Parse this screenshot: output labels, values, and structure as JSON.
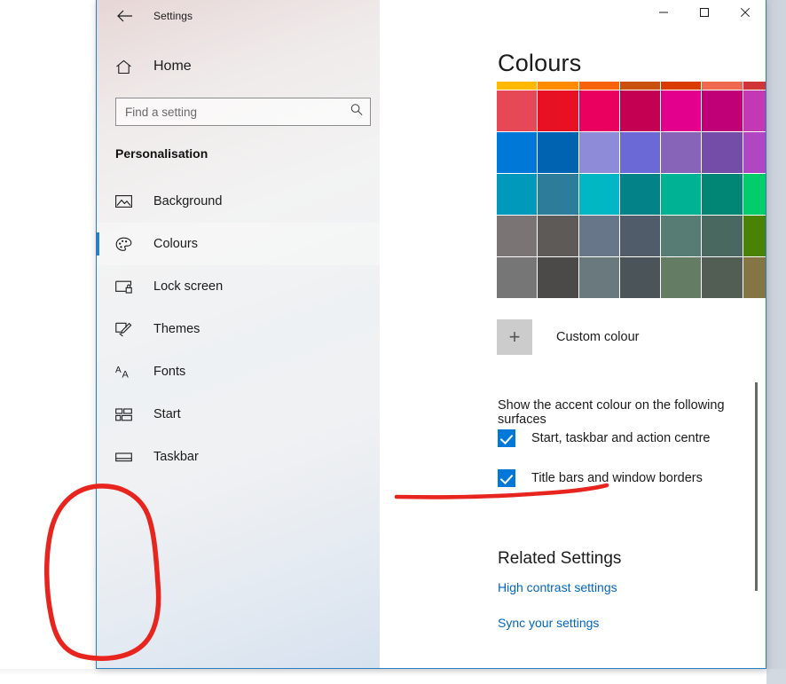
{
  "window": {
    "title": "Settings",
    "back_icon": "back-arrow-icon",
    "controls": {
      "minimize": "─",
      "maximize": "□",
      "close": "✕"
    },
    "accent_border_colour": "#2a7fc4"
  },
  "sidebar": {
    "home": {
      "label": "Home",
      "icon": "home-icon"
    },
    "search": {
      "placeholder": "Find a setting",
      "value": "",
      "icon": "search-icon"
    },
    "category": "Personalisation",
    "items": [
      {
        "label": "Background",
        "icon": "picture-icon",
        "selected": false
      },
      {
        "label": "Colours",
        "icon": "palette-icon",
        "selected": true
      },
      {
        "label": "Lock screen",
        "icon": "lock-screen-icon",
        "selected": false
      },
      {
        "label": "Themes",
        "icon": "brush-icon",
        "selected": false
      },
      {
        "label": "Fonts",
        "icon": "font-icon",
        "selected": false
      },
      {
        "label": "Start",
        "icon": "start-tiles-icon",
        "selected": false
      },
      {
        "label": "Taskbar",
        "icon": "taskbar-icon",
        "selected": false
      }
    ]
  },
  "main": {
    "heading": "Colours",
    "swatch_rows": [
      {
        "clipped": true,
        "colours": [
          "#ffb900",
          "#ff8c00",
          "#f7630c",
          "#ca5010",
          "#da3b01",
          "#ef6950",
          "#d13438",
          "#ff4343"
        ]
      },
      {
        "clipped": false,
        "colours": [
          "#e74856",
          "#e81123",
          "#ea005e",
          "#c30052",
          "#e3008c",
          "#bf0077",
          "#c239b3",
          "#9a0089"
        ]
      },
      {
        "clipped": false,
        "colours": [
          "#0078d7",
          "#0063b1",
          "#8e8cd8",
          "#6b69d6",
          "#8764b8",
          "#744da9",
          "#b146c2",
          "#881798"
        ]
      },
      {
        "clipped": false,
        "colours": [
          "#0099bc",
          "#2d7d9a",
          "#00b7c3",
          "#038387",
          "#00b294",
          "#018574",
          "#00cc6a",
          "#10893e"
        ]
      },
      {
        "clipped": false,
        "colours": [
          "#7a7574",
          "#5d5a58",
          "#68768a",
          "#515c6b",
          "#567c73",
          "#486860",
          "#498205",
          "#107c10"
        ]
      },
      {
        "clipped": false,
        "colours": [
          "#767676",
          "#4c4a48",
          "#69797e",
          "#4a5459",
          "#647c64",
          "#525e54",
          "#847545",
          "#7e735f"
        ]
      }
    ],
    "custom_colour": {
      "label": "Custom colour",
      "icon": "plus-icon"
    },
    "surfaces_heading": "Show the accent colour on the following surfaces",
    "checkboxes": [
      {
        "label": "Start, taskbar and action centre",
        "checked": true
      },
      {
        "label": "Title bars and window borders",
        "checked": true
      }
    ],
    "related": {
      "heading": "Related Settings",
      "links": [
        "High contrast settings",
        "Sync your settings"
      ]
    }
  },
  "annotations": {
    "colour": "#e8241f",
    "shapes": [
      "red-circle-annotation",
      "red-underline-annotation"
    ]
  }
}
